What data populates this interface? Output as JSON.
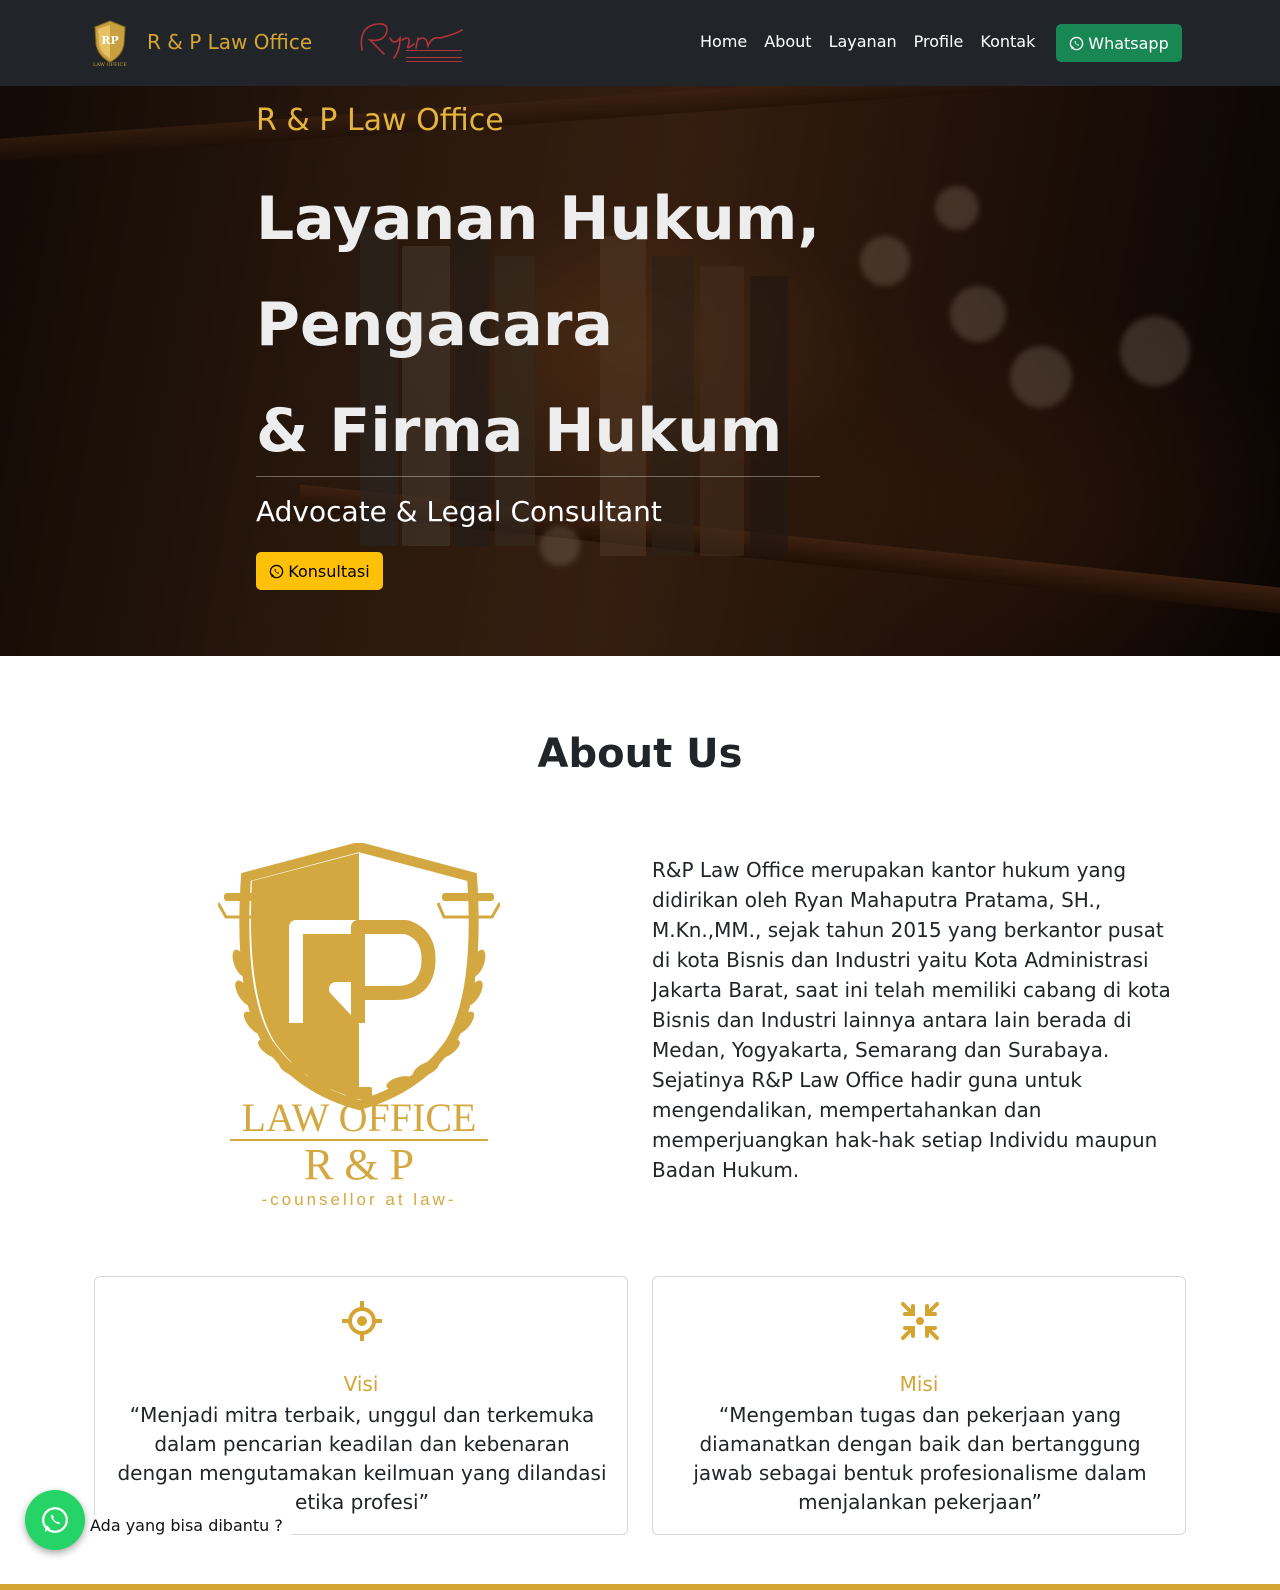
{
  "navbar": {
    "brand_name": "R & P Law Office",
    "partner_logo": "ryan-enterprise-logo",
    "links": [
      "Home",
      "About",
      "Layanan",
      "Profile",
      "Kontak"
    ],
    "whatsapp_label": "Whatsapp",
    "whatsapp_color": "#198754"
  },
  "hero": {
    "eyebrow": "R & P Law Office",
    "title_lines": [
      "Layanan Hukum,",
      "Pengacara",
      "& Firma Hukum"
    ],
    "subtitle": "Advocate & Legal Consultant",
    "cta_label": "Konsultasi",
    "cta_color": "#ffc107"
  },
  "about": {
    "title": "About Us",
    "logo": {
      "name": "rp-law-office-logo",
      "line1": "LAW OFFICE",
      "line2": "R & P",
      "line3": "-counsellor at law-"
    },
    "description": "R&P Law Office merupakan kantor hukum yang didirikan oleh Ryan Mahaputra Pratama, SH., M.Kn.,MM., sejak tahun 2015 yang berkantor pusat di kota Bisnis dan Industri yaitu Kota Administrasi Jakarta Barat, saat ini telah memiliki cabang di kota Bisnis dan Industri lainnya antara lain berada di Medan, Yogyakarta, Semarang dan Surabaya. Sejatinya R&P Law Office hadir guna untuk mengendalikan, mempertahankan dan memperjuangkan hak-hak setiap Individu maupun Badan Hukum."
  },
  "cards": [
    {
      "icon": "crosshair-icon",
      "title": "Visi",
      "text": "“Menjadi mitra terbaik, unggul dan terkemuka dalam pencarian keadilan dan kebenaran dengan mengutamakan keilmuan yang dilandasi etika profesi”"
    },
    {
      "icon": "arrows-inward-icon",
      "title": "Misi",
      "text": "“Mengemban tugas dan pekerjaan yang diamanatkan dengan baik dan bertanggung jawab sebagai bentuk profesionalisme dalam menjalankan pekerjaan”"
    }
  ],
  "floating_chat": {
    "label": "Ada yang bisa dibantu ?",
    "icon": "whatsapp-icon"
  },
  "colors": {
    "gold": "#d4a533",
    "dark": "#212529",
    "whatsapp_float": "#25d366"
  }
}
